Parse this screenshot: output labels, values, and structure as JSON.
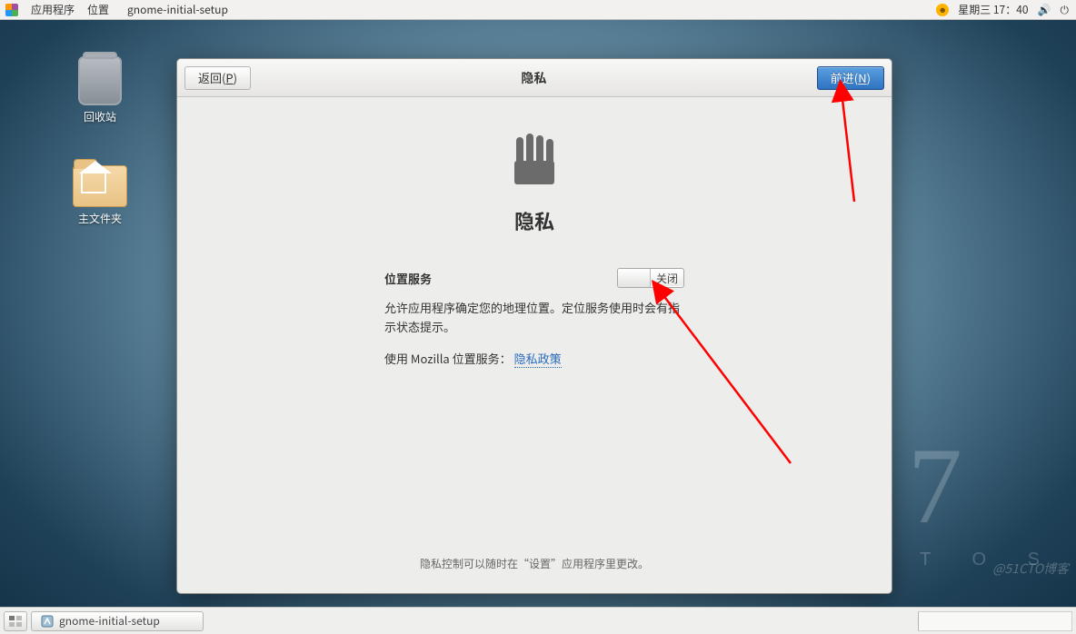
{
  "panel": {
    "apps": "应用程序",
    "places": "位置",
    "app_title": "gnome-initial-setup",
    "date": "星期三 17：40"
  },
  "desktop_icons": {
    "trash": "回收站",
    "home": "主文件夹"
  },
  "dialog": {
    "back": "返回(",
    "back_key": "P",
    "back_suffix": ")",
    "title": "隐私",
    "next": "前进(",
    "next_key": "N",
    "next_suffix": ")",
    "heading": "隐私",
    "location_label": "位置服务",
    "switch_state": "关闭",
    "description": "允许应用程序确定您的地理位置。定位服务使用时会有指示状态提示。",
    "policy_prefix": "使用  Mozilla 位置服务：",
    "policy_link": "隐私政策",
    "footer": "隐私控制可以随时在“设置”应用程序里更改。"
  },
  "taskbar": {
    "task1": "gnome-initial-setup"
  },
  "watermark": "@51CTO博客",
  "centos": {
    "ver": "7",
    "name": "E N T O S"
  }
}
